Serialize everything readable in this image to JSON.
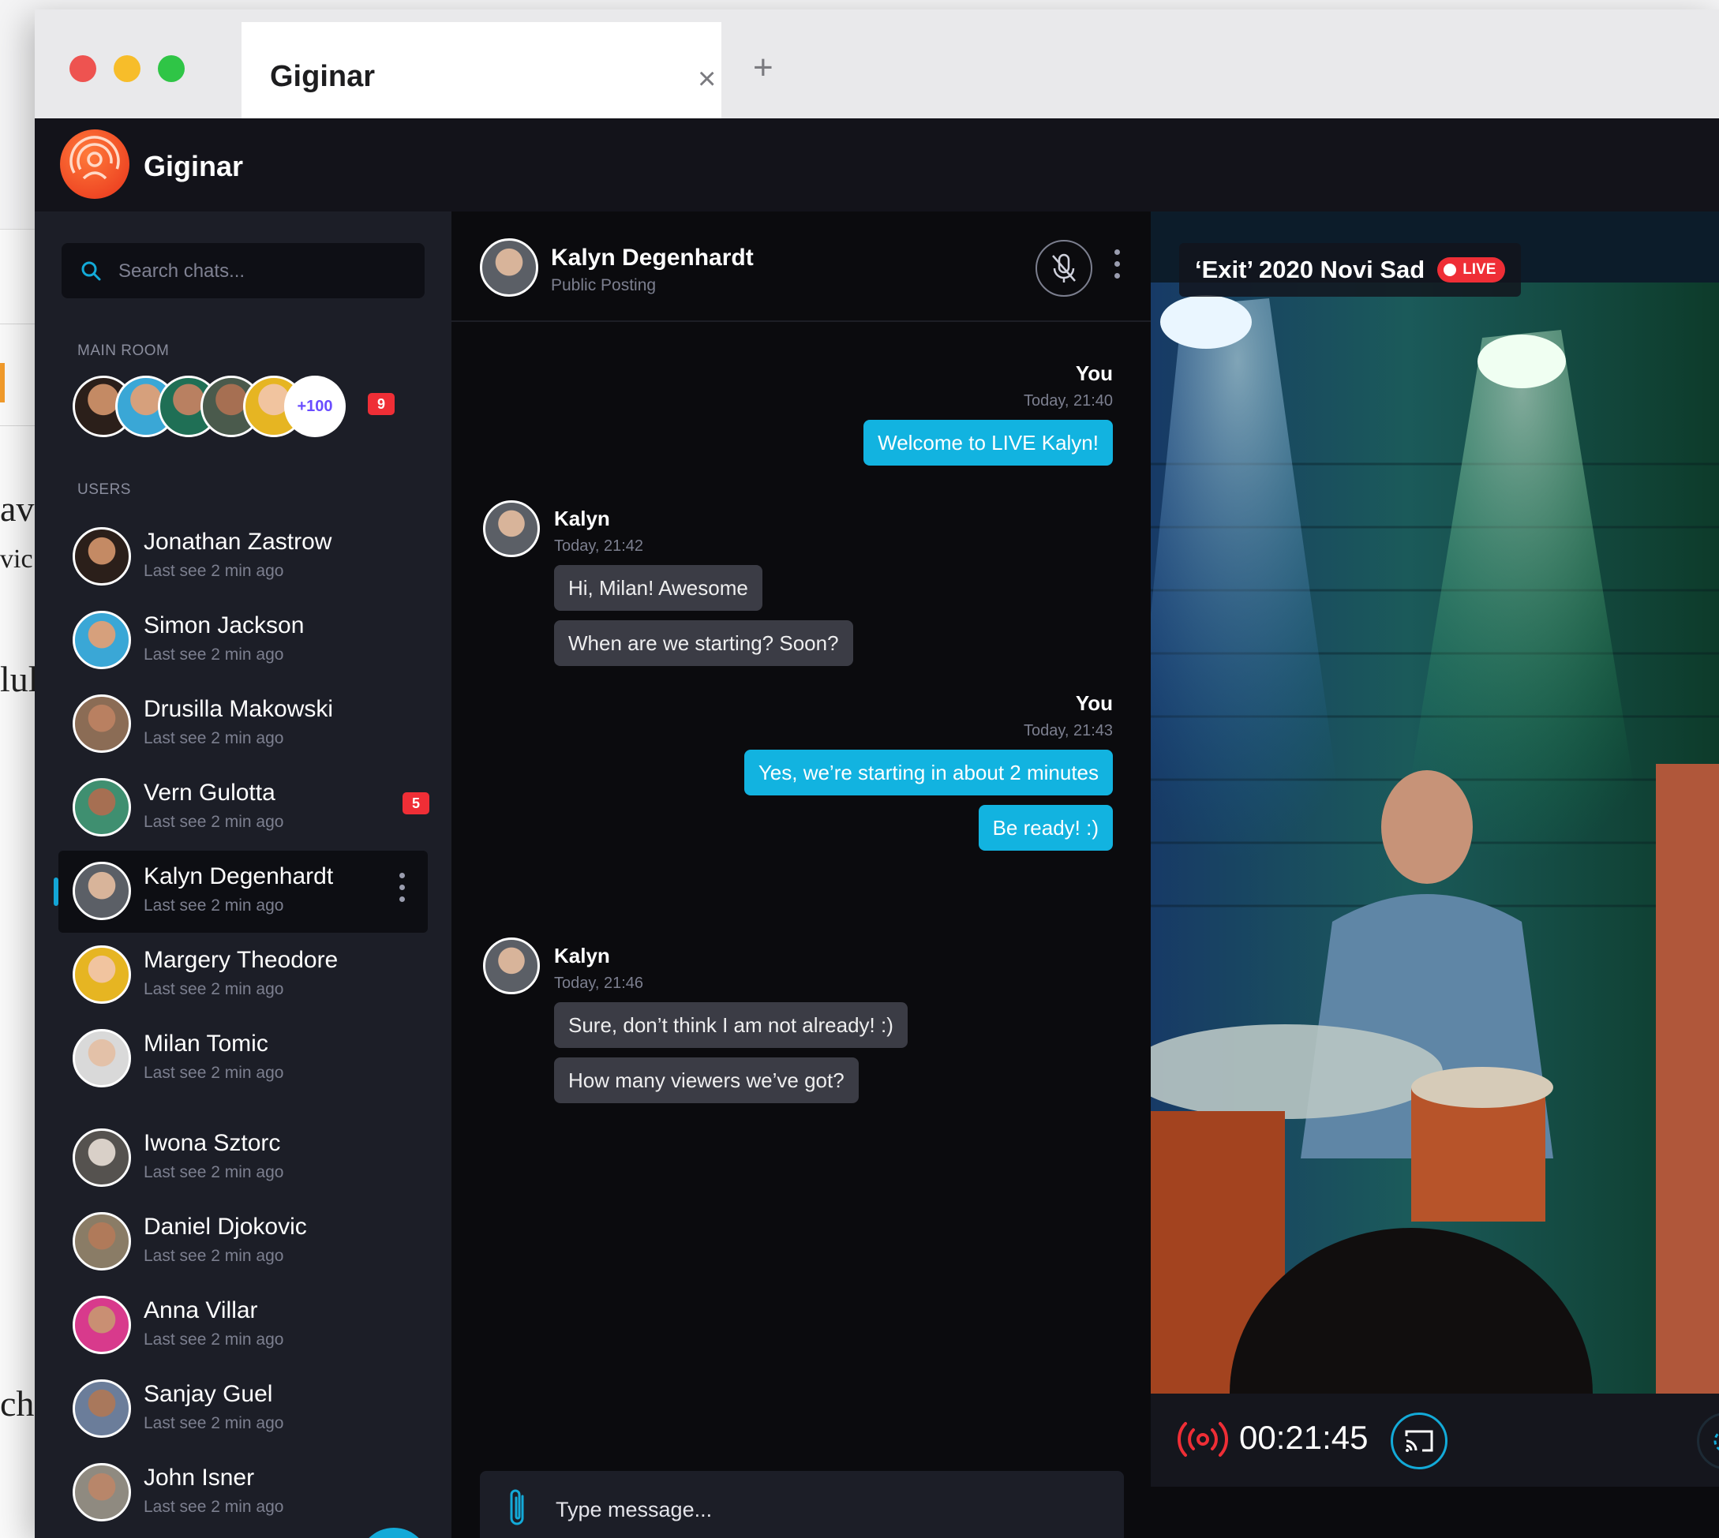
{
  "background_doc": {
    "fragments": [
      "av",
      "vic",
      "lul",
      "ch"
    ]
  },
  "browser": {
    "tab_title": "Giginar",
    "tab_close_glyph": "×",
    "new_tab_glyph": "+"
  },
  "app": {
    "title": "Giginar",
    "logo_icon": "broadcast-person-icon",
    "brand_color": "#e8331b",
    "accent_color": "#13aad8"
  },
  "sidebar": {
    "search_placeholder": "Search chats...",
    "main_room_label": "MAIN ROOM",
    "main_room_more": "+100",
    "main_room_badge": "9",
    "users_label": "USERS",
    "users": [
      {
        "name": "Jonathan Zastrow",
        "status": "Last see 2 min ago"
      },
      {
        "name": "Simon Jackson",
        "status": "Last see 2 min ago"
      },
      {
        "name": "Drusilla Makowski",
        "status": "Last see 2 min ago"
      },
      {
        "name": "Vern Gulotta",
        "status": "Last see 2 min ago",
        "badge": "5"
      },
      {
        "name": "Kalyn Degenhardt",
        "status": "Last see 2 min ago"
      },
      {
        "name": "Margery Theodore",
        "status": "Last see 2 min ago"
      },
      {
        "name": "Milan Tomic",
        "status": "Last see 2 min ago"
      },
      {
        "name": "Iwona Sztorc",
        "status": "Last see 2 min ago"
      },
      {
        "name": "Daniel Djokovic",
        "status": "Last see 2 min ago"
      },
      {
        "name": "Anna Villar",
        "status": "Last see 2 min ago"
      },
      {
        "name": "Sanjay Guel",
        "status": "Last see 2 min ago"
      },
      {
        "name": "John Isner",
        "status": "Last see 2 min ago"
      }
    ]
  },
  "chat": {
    "contact_name": "Kalyn Degenhardt",
    "contact_sub": "Public Posting",
    "groups": [
      {
        "who": "You",
        "time": "Today, 21:40",
        "messages": [
          "Welcome to LIVE Kalyn!"
        ]
      },
      {
        "who": "Kalyn",
        "time": "Today, 21:42",
        "messages": [
          "Hi, Milan! Awesome",
          "When are we starting? Soon?"
        ]
      },
      {
        "who": "You",
        "time": "Today, 21:43",
        "messages": [
          "Yes, we’re starting in about 2 minutes",
          "Be ready! :)"
        ]
      },
      {
        "who": "Kalyn",
        "time": "Today, 21:46",
        "messages": [
          "Sure, don’t think I am not already! :)",
          "How many viewers we’ve got?"
        ]
      }
    ],
    "composer_placeholder": "Type message..."
  },
  "video": {
    "stream_title": "‘Exit’ 2020 Novi Sad",
    "live_label": "LIVE",
    "timer": "00:21:45"
  }
}
